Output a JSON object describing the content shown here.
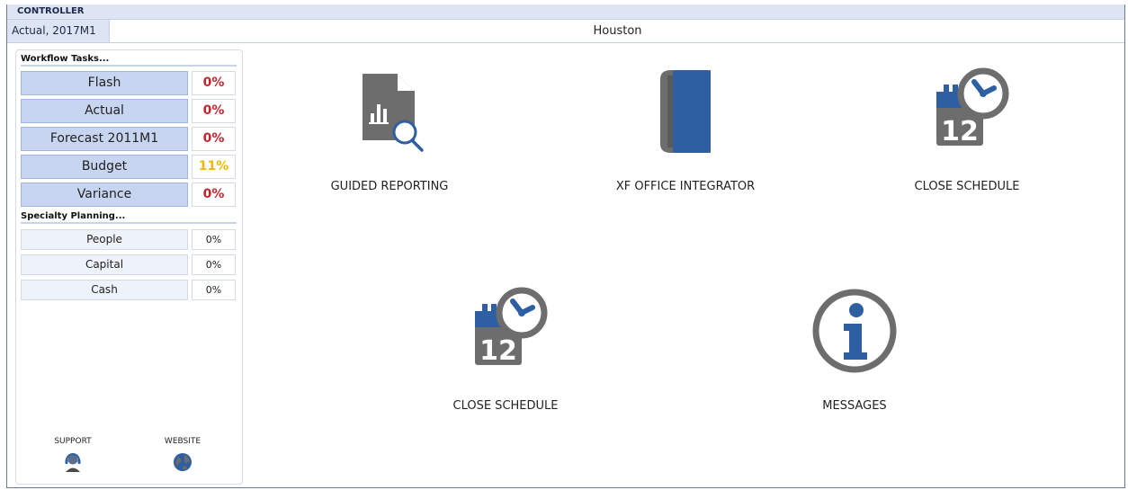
{
  "window": {
    "title": "CONTROLLER"
  },
  "context": {
    "scenario_period": "Actual, 2017M1",
    "entity": "Houston"
  },
  "sidebar": {
    "workflow_heading": "Workflow Tasks...",
    "workflow_tasks": [
      {
        "label": "Flash",
        "pct": "0%",
        "status_color": "#c0262d"
      },
      {
        "label": "Actual",
        "pct": "0%",
        "status_color": "#c0262d"
      },
      {
        "label": "Forecast 2011M1",
        "pct": "0%",
        "status_color": "#c0262d"
      },
      {
        "label": "Budget",
        "pct": "11%",
        "status_color": "#f2b705"
      },
      {
        "label": "Variance",
        "pct": "0%",
        "status_color": "#c0262d"
      }
    ],
    "specialty_heading": "Specialty Planning...",
    "specialty_tasks": [
      {
        "label": "People",
        "pct": "0%"
      },
      {
        "label": "Capital",
        "pct": "0%"
      },
      {
        "label": "Cash",
        "pct": "0%"
      }
    ],
    "footer": {
      "support_label": "SUPPORT",
      "support_icon": "headset-icon",
      "website_label": "WEBSITE",
      "website_icon": "globe-icon"
    }
  },
  "tiles": [
    {
      "label": "GUIDED REPORTING",
      "icon": "report-search-icon"
    },
    {
      "label": "XF OFFICE INTEGRATOR",
      "icon": "book-icon"
    },
    {
      "label": "CLOSE SCHEDULE",
      "icon": "calendar-clock-icon"
    },
    {
      "label": "CLOSE SCHEDULE",
      "icon": "calendar-clock-icon"
    },
    {
      "label": "MESSAGES",
      "icon": "info-icon"
    }
  ],
  "colors": {
    "accent_blue": "#2e5fa3",
    "icon_gray": "#6d6d6d",
    "task_fill": "#c7d5f0"
  }
}
